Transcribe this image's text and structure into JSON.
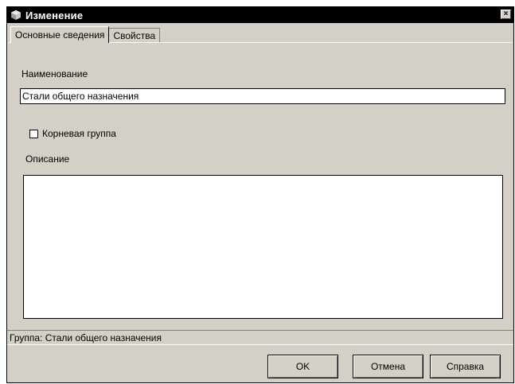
{
  "window": {
    "title": "Изменение",
    "close_symbol": "×"
  },
  "icons": {
    "app": "cube-app-icon",
    "close": "close-icon"
  },
  "tabs": [
    {
      "label": "Основные сведения",
      "active": true
    },
    {
      "label": "Свойства",
      "active": false
    }
  ],
  "form": {
    "name_label": "Наименование",
    "name_value": "Стали общего назначения",
    "root_group_label": "Корневая группа",
    "root_group_checked": false,
    "description_label": "Описание",
    "description_value": ""
  },
  "status": {
    "text": "Группа: Стали общего назначения"
  },
  "buttons": {
    "ok": "OK",
    "cancel": "Отмена",
    "help": "Справка"
  },
  "colors": {
    "face": "#d4d0c8",
    "titlebar": "#000000",
    "field": "#ffffff"
  }
}
